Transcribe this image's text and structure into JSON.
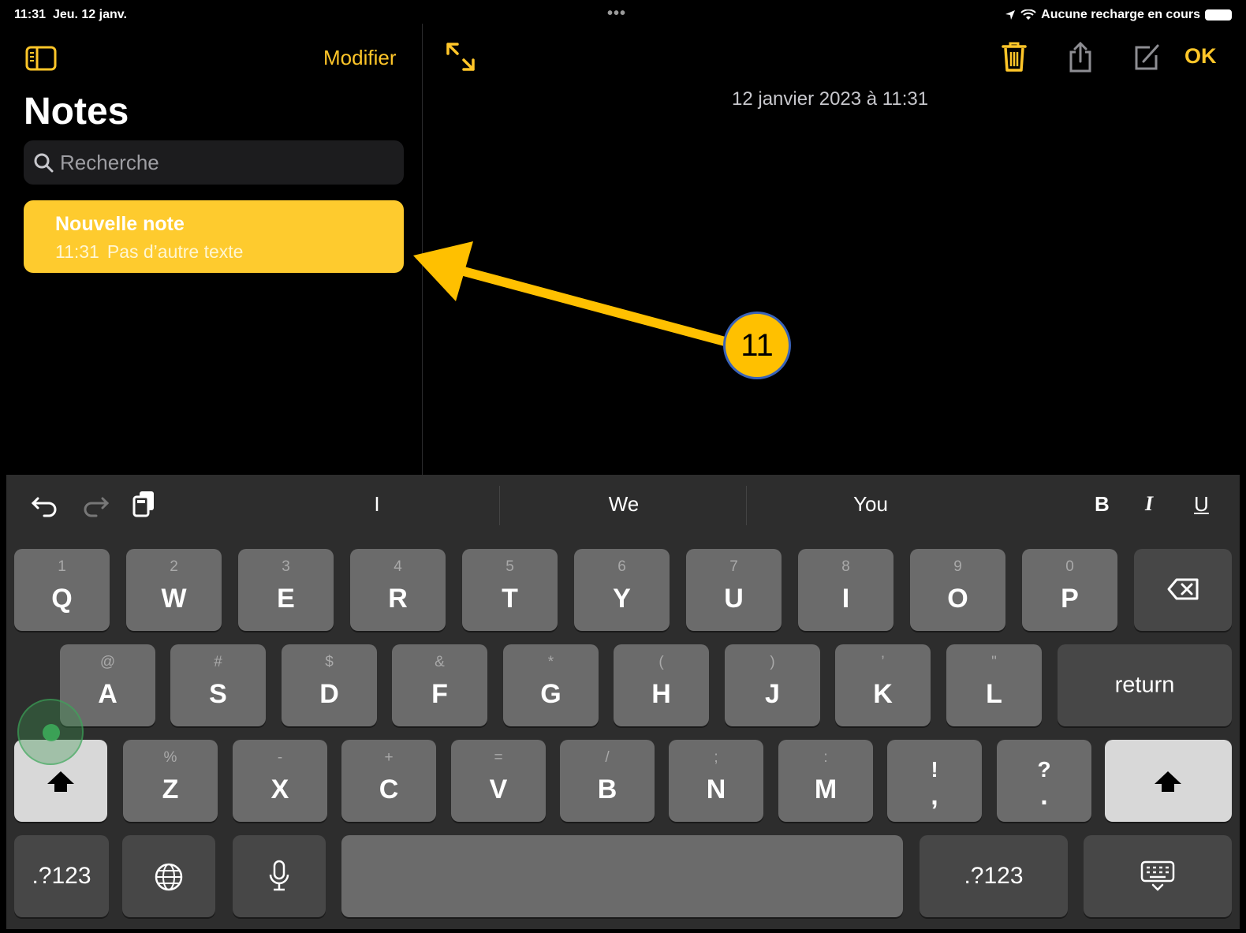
{
  "status": {
    "time": "11:31",
    "date": "Jeu. 12 janv.",
    "charging": "Aucune recharge en cours"
  },
  "sidebar": {
    "edit_label": "Modifier",
    "title": "Notes",
    "search_placeholder": "Recherche",
    "notes": [
      {
        "title": "Nouvelle note",
        "time": "11:31",
        "preview": "Pas d’autre texte"
      }
    ]
  },
  "detail": {
    "timestamp": "12 janvier 2023 à 11:31",
    "done_label": "OK"
  },
  "annotation": {
    "step": "11",
    "badge_color": "#ffc000",
    "arrow_color": "#ffc000"
  },
  "keyboard": {
    "suggestions": [
      "I",
      "We",
      "You"
    ],
    "format": [
      "B",
      "I",
      "U"
    ],
    "row1": [
      {
        "k": "Q",
        "s": "1"
      },
      {
        "k": "W",
        "s": "2"
      },
      {
        "k": "E",
        "s": "3"
      },
      {
        "k": "R",
        "s": "4"
      },
      {
        "k": "T",
        "s": "5"
      },
      {
        "k": "Y",
        "s": "6"
      },
      {
        "k": "U",
        "s": "7"
      },
      {
        "k": "I",
        "s": "8"
      },
      {
        "k": "O",
        "s": "9"
      },
      {
        "k": "P",
        "s": "0"
      }
    ],
    "row2": [
      {
        "k": "A",
        "s": "@"
      },
      {
        "k": "S",
        "s": "#"
      },
      {
        "k": "D",
        "s": "$"
      },
      {
        "k": "F",
        "s": "&"
      },
      {
        "k": "G",
        "s": "*"
      },
      {
        "k": "H",
        "s": "("
      },
      {
        "k": "J",
        "s": ")"
      },
      {
        "k": "K",
        "s": "’"
      },
      {
        "k": "L",
        "s": "\""
      }
    ],
    "row3": [
      {
        "k": "Z",
        "s": "%"
      },
      {
        "k": "X",
        "s": "-"
      },
      {
        "k": "C",
        "s": "+"
      },
      {
        "k": "V",
        "s": "="
      },
      {
        "k": "B",
        "s": "/"
      },
      {
        "k": "N",
        "s": ";"
      },
      {
        "k": "M",
        "s": ":"
      },
      {
        "k": ",",
        "s": "!"
      },
      {
        "k": ".",
        "s": "?"
      }
    ],
    "return_label": "return",
    "numbers_label": ".?123"
  },
  "accent_color": "#ffc629"
}
